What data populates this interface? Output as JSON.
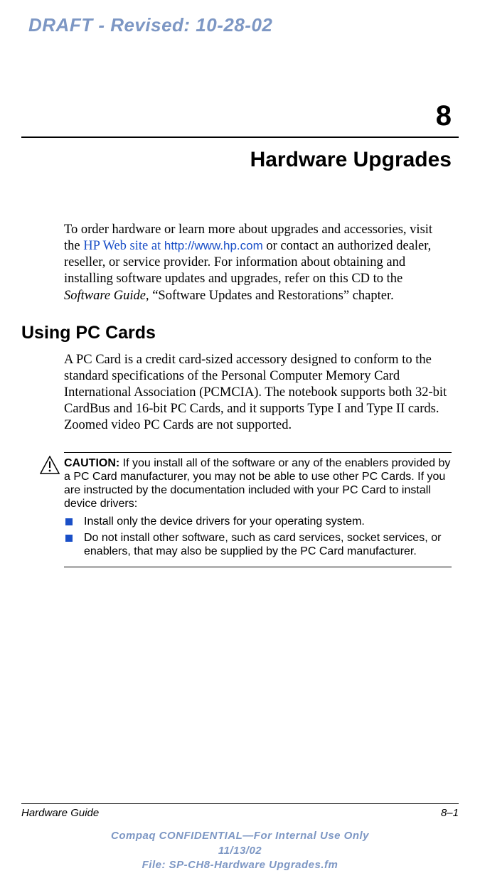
{
  "draft_banner": "DRAFT - Revised: 10-28-02",
  "chapter_number": "8",
  "chapter_title": "Hardware Upgrades",
  "intro": {
    "pre": "To order hardware or learn more about upgrades and accessories, visit the ",
    "link_text": "HP Web site at ",
    "link_url": "http://www.hp.com",
    "post1": " or contact an authorized dealer, reseller, or service provider. For information about obtaining and installing software updates and upgrades, refer on this CD to the ",
    "italic": "Software Guide,",
    "post2": " “Software Updates and Restorations” chapter."
  },
  "section_heading": "Using PC Cards",
  "section_body": "A PC Card is a credit card-sized accessory designed to conform to the standard specifications of the Personal Computer Memory Card International Association (PCMCIA). The notebook supports both 32-bit CardBus and 16-bit PC Cards, and it supports Type I and Type II cards. Zoomed video PC Cards are not supported.",
  "caution": {
    "label": "CAUTION:",
    "text": " If you install all of the software or any of the enablers provided by a PC Card manufacturer, you may not be able to use other PC Cards. If you are instructed by the documentation included with your PC Card to install device drivers:",
    "bullets": [
      "Install only the device drivers for your operating system.",
      "Do not install other software, such as card services, socket services, or enablers, that may also be supplied by the PC Card manufacturer."
    ]
  },
  "footer": {
    "left": "Hardware Guide",
    "right": "8–1",
    "confidential_line1": "Compaq CONFIDENTIAL—For Internal Use Only",
    "confidential_line2": "11/13/02",
    "confidential_line3": "File: SP-CH8-Hardware Upgrades.fm"
  }
}
